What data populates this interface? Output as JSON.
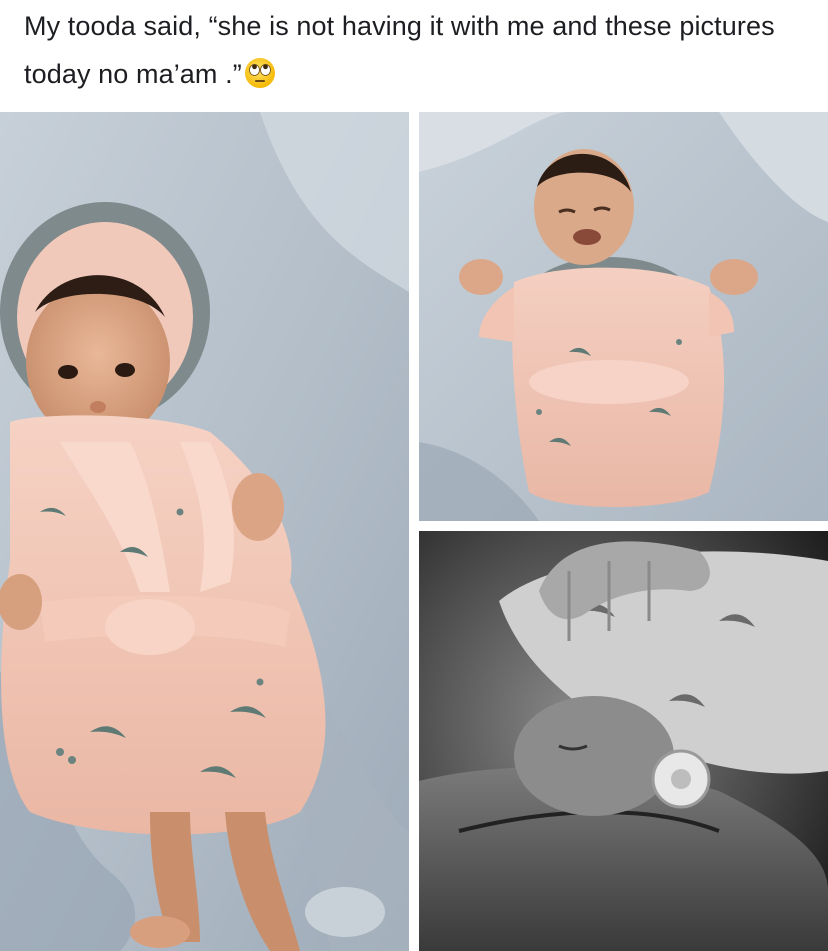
{
  "post": {
    "caption": "My tooda said, “she is not having it with me and these pictures today no ma’am .”",
    "emoji": "eye-roll-emoji"
  },
  "photos": [
    {
      "id": "photo-1",
      "style": "color",
      "subject": "baby-in-pink-robe-hood-up"
    },
    {
      "id": "photo-2",
      "style": "color",
      "subject": "baby-crying-arms-up"
    },
    {
      "id": "photo-3",
      "style": "black-and-white",
      "subject": "newborn-with-pacifier"
    }
  ],
  "colors": {
    "text": "#1c1e21",
    "robe_pink": "#f2c6b6",
    "bedding_gray": "#b8c2cc",
    "hood_trim": "#7e8a8c",
    "moon_teal": "#5f7a74"
  }
}
